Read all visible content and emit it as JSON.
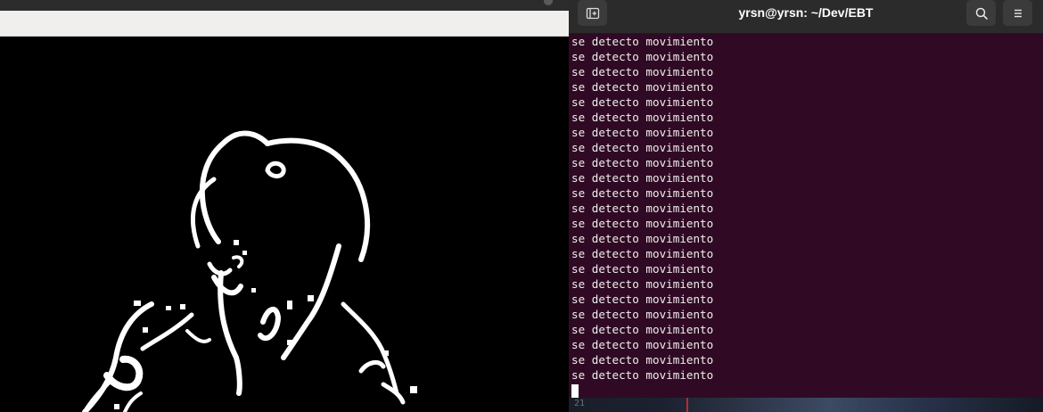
{
  "terminal": {
    "title": "yrsn@yrsn: ~/Dev/EBT",
    "output_lines": [
      "se detecto movimiento",
      "se detecto movimiento",
      "se detecto movimiento",
      "se detecto movimiento",
      "se detecto movimiento",
      "se detecto movimiento",
      "se detecto movimiento",
      "se detecto movimiento",
      "se detecto movimiento",
      "se detecto movimiento",
      "se detecto movimiento",
      "se detecto movimiento",
      "se detecto movimiento",
      "se detecto movimiento",
      "se detecto movimiento",
      "se detecto movimiento",
      "se detecto movimiento",
      "se detecto movimiento",
      "se detecto movimiento",
      "se detecto movimiento",
      "se detecto movimiento",
      "se detecto movimiento",
      "se detecto movimiento"
    ],
    "icons": {
      "new_tab": "new-tab-icon",
      "search": "search-icon",
      "menu": "hamburger-menu-icon"
    },
    "colors": {
      "background": "#300a24",
      "text": "#eeeeec",
      "header": "#2b2b2b"
    }
  },
  "background_window": {
    "peek_text": "21"
  },
  "video": {
    "description_icon": "edge-detection-frame"
  }
}
